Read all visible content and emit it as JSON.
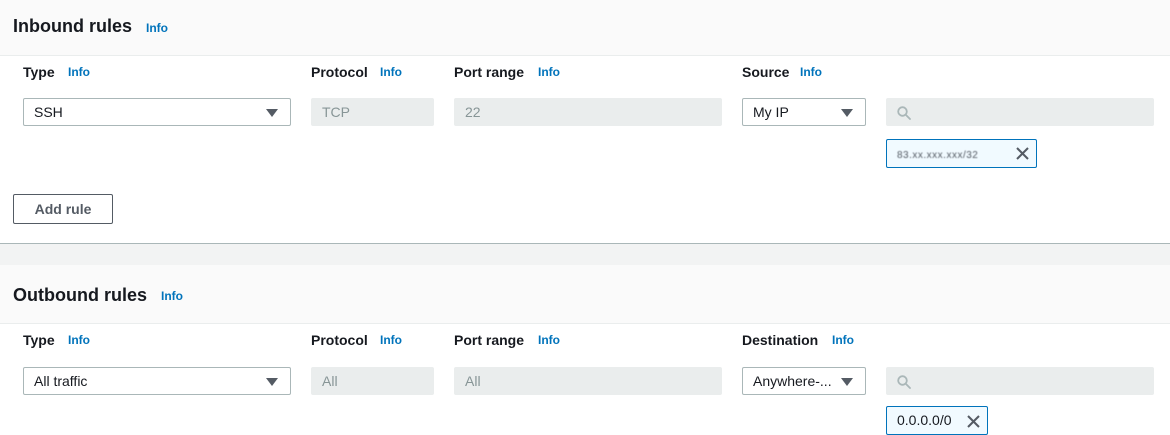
{
  "inbound": {
    "title": "Inbound rules",
    "info": "Info",
    "columns": {
      "type": "Type",
      "protocol": "Protocol",
      "port_range": "Port range",
      "source": "Source",
      "info": "Info"
    },
    "row": {
      "type": "SSH",
      "protocol": "TCP",
      "port_range": "22",
      "source": "My IP",
      "search_placeholder": "",
      "token": "83.xx.xxx.xxx/32"
    },
    "add_rule": "Add rule"
  },
  "outbound": {
    "title": "Outbound rules",
    "info": "Info",
    "columns": {
      "type": "Type",
      "protocol": "Protocol",
      "port_range": "Port range",
      "destination": "Destination",
      "info": "Info"
    },
    "row": {
      "type": "All traffic",
      "protocol": "All",
      "port_range": "All",
      "destination": "Anywhere-...",
      "search_placeholder": "",
      "token": "0.0.0.0/0"
    }
  },
  "colors": {
    "link": "#0073bb",
    "token_border": "#0073bb",
    "readonly_bg": "#eaeded"
  }
}
